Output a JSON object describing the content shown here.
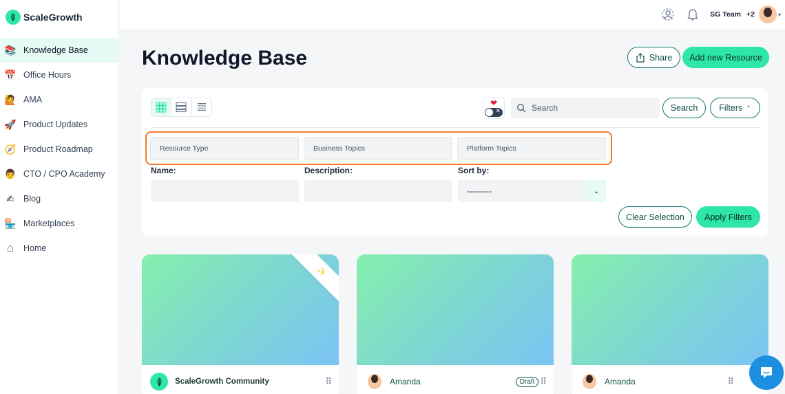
{
  "brand": {
    "name": "ScaleGrowth"
  },
  "sidebar": {
    "items": [
      {
        "label": "Knowledge Base",
        "icon": "books-icon",
        "emoji": "📚",
        "active": true
      },
      {
        "label": "Office Hours",
        "icon": "calendar-icon",
        "emoji": "📅"
      },
      {
        "label": "AMA",
        "icon": "raising-hand-icon",
        "emoji": "🙋"
      },
      {
        "label": "Product Updates",
        "icon": "rocket-icon",
        "emoji": "🚀"
      },
      {
        "label": "Product Roadmap",
        "icon": "compass-icon",
        "emoji": "🧭"
      },
      {
        "label": "CTO / CPO Academy",
        "icon": "person-icon",
        "emoji": "👨"
      },
      {
        "label": "Blog",
        "icon": "writing-hand-icon",
        "emoji": "✍"
      },
      {
        "label": "Marketplaces",
        "icon": "store-icon",
        "emoji": "🏪"
      },
      {
        "label": "Home",
        "icon": "home-icon",
        "emoji": "⌂"
      }
    ]
  },
  "topbar": {
    "team_name": "SG Team",
    "team_count": "+2"
  },
  "header": {
    "title": "Knowledge Base",
    "share_label": "Share",
    "add_label": "Add new Resource"
  },
  "filters": {
    "search_placeholder": "Search",
    "search_button": "Search",
    "filters_button": "Filters",
    "dropdowns": [
      "Resource Type",
      "Business Topics",
      "Platform Topics"
    ],
    "name_label": "Name:",
    "description_label": "Description:",
    "sort_label": "Sort by:",
    "sort_value": "---------",
    "clear_button": "Clear Selection",
    "apply_button": "Apply Filters"
  },
  "cards": [
    {
      "author": "ScaleGrowth Community",
      "badge": "",
      "featured": true
    },
    {
      "author": "Amanda",
      "badge": "Draft"
    },
    {
      "author": "Amanda",
      "badge": ""
    }
  ],
  "colors": {
    "accent": "#2ee6a6",
    "highlight": "#f07c2b",
    "dark_teal": "#0f5148",
    "chat": "#1d8fe0"
  }
}
